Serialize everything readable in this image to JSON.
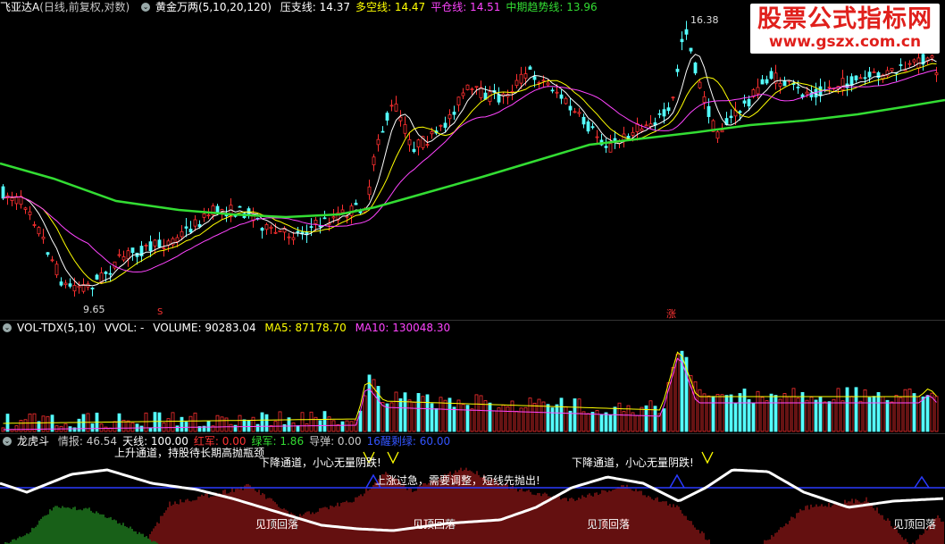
{
  "main": {
    "stock_name": "飞亚达A",
    "mode": "(日线,前复权,对数)",
    "indicator": "黄金万两(5,10,20,120)",
    "fields": [
      {
        "label": "压支线:",
        "value": "14.37",
        "color": "#ffffff"
      },
      {
        "label": "多空线:",
        "value": "14.47",
        "color": "#ffff00"
      },
      {
        "label": "平仓线:",
        "value": "14.51",
        "color": "#ff44ff"
      },
      {
        "label": "中期趋势线:",
        "value": "13.96",
        "color": "#33dd33"
      }
    ],
    "high_label": "16.38",
    "low_label": "9.65",
    "marker_zhang": "涨",
    "marker_s": "S"
  },
  "watermark": {
    "title": "股票公式指标网",
    "url": "www.gszx.com.cn"
  },
  "volume": {
    "indicator": "VOL-TDX(5,10)",
    "vvol": "VVOL: -",
    "volume": "VOLUME: 90283.04",
    "ma5": "MA5: 87178.70",
    "ma10": "MA10: 130048.30"
  },
  "lhd": {
    "name": "龙虎斗",
    "fields": [
      {
        "label": "情报:",
        "value": "46.54",
        "color": "#c8c8c8"
      },
      {
        "label": "天线:",
        "value": "100.00",
        "color": "#ffffff"
      },
      {
        "label": "红军:",
        "value": "0.00",
        "color": "#ff3333"
      },
      {
        "label": "绿军:",
        "value": "1.86",
        "color": "#33dd33"
      },
      {
        "label": "导弹:",
        "value": "0.00",
        "color": "#c8c8c8"
      },
      {
        "label": "16醒剩绿:",
        "value": "60.00",
        "color": "#3355ff"
      }
    ],
    "notes": {
      "top_cut": "上升通道，持股待长期高抛瓶颈",
      "down1": "下降通道，小心无量阴跌!",
      "down2": "下降通道，小心无量阴跌!",
      "up_warn": "上涨过急，需要调整，短线先抛出!",
      "peak1": "见顶回落",
      "peak2": "见顶回落",
      "peak3": "见顶回落",
      "peak4": "见顶回落"
    }
  },
  "colors": {
    "up": "#ff3030",
    "down": "#54ffff",
    "ma5": "#ffffff",
    "ma10": "#ffff00",
    "ma20": "#ff44ff",
    "ma120": "#33dd33"
  }
}
